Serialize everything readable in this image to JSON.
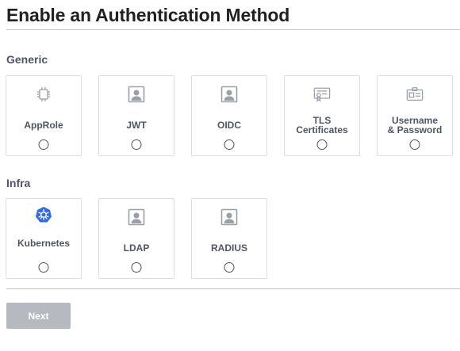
{
  "page": {
    "title": "Enable an Authentication Method"
  },
  "sections": {
    "generic": {
      "title": "Generic",
      "items": [
        {
          "label": "AppRole",
          "icon": "chip-icon"
        },
        {
          "label": "JWT",
          "icon": "user-box-icon"
        },
        {
          "label": "OIDC",
          "icon": "user-box-icon"
        },
        {
          "label": "TLS\nCertificates",
          "icon": "certificate-icon"
        },
        {
          "label": "Username\n& Password",
          "icon": "id-card-icon"
        }
      ]
    },
    "infra": {
      "title": "Infra",
      "items": [
        {
          "label": "Kubernetes",
          "icon": "kubernetes-icon"
        },
        {
          "label": "LDAP",
          "icon": "user-box-icon"
        },
        {
          "label": "RADIUS",
          "icon": "user-box-icon"
        }
      ]
    }
  },
  "footer": {
    "next_label": "Next"
  },
  "colors": {
    "icon_gray": "#9aa0aa",
    "kubernetes_blue": "#326ce5",
    "button_disabled": "#b6b9bf"
  }
}
